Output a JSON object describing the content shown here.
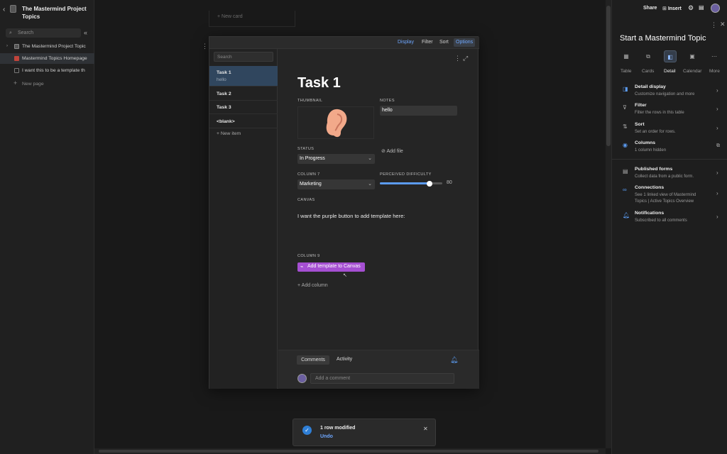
{
  "sidebar": {
    "title": "The Mastermind Project Topics",
    "search_placeholder": "Search",
    "items": [
      {
        "label": "The Mastermind Project Topic"
      },
      {
        "label": "Mastermind Topics Homepage"
      },
      {
        "label": "I want this to be a template th"
      }
    ],
    "new_page": "New page"
  },
  "board": {
    "new_card": "+ New card"
  },
  "modal": {
    "toolbar": {
      "display": "Display",
      "filter": "Filter",
      "sort": "Sort",
      "options": "Options"
    },
    "list_search_placeholder": "Search",
    "list": [
      {
        "title": "Task 1",
        "sub": "hello"
      },
      {
        "title": "Task 2"
      },
      {
        "title": "Task 3"
      },
      {
        "title": "<blank>"
      }
    ],
    "new_item": "+  New item",
    "detail": {
      "title": "Task 1",
      "thumbnail_label": "THUMBNAIL",
      "notes_label": "NOTES",
      "notes_value": "hello",
      "add_file": "Add file",
      "status_label": "STATUS",
      "status_value": "In Progress",
      "column7_label": "COLUMN 7",
      "column7_value": "Marketing",
      "difficulty_label": "PERCEIVED DIFFICULTY",
      "difficulty_value": "80",
      "difficulty_fraction": 0.8,
      "canvas_label": "CANVAS",
      "canvas_text": "I want the purple button to add template here:",
      "column9_label": "COLUMN 9",
      "button_label": "Add template to Canvas",
      "button_color": "#a54fd2",
      "add_column": "+ Add column"
    },
    "comments": {
      "tab_comments": "Comments",
      "tab_activity": "Activity",
      "placeholder": "Add a comment"
    }
  },
  "toast": {
    "message": "1 row modified",
    "action": "Undo"
  },
  "right_panel": {
    "share": "Share",
    "insert": "Insert",
    "title": "Start a Mastermind Topic",
    "views": [
      {
        "label": "Table",
        "icon": "table-icon"
      },
      {
        "label": "Cards",
        "icon": "cards-icon"
      },
      {
        "label": "Detail",
        "icon": "detail-icon"
      },
      {
        "label": "Calendar",
        "icon": "calendar-icon"
      },
      {
        "label": "More",
        "icon": "more-icon"
      }
    ],
    "rows": [
      {
        "title": "Detail display",
        "sub": "Customize navigation and more"
      },
      {
        "title": "Filter",
        "sub": "Filter the rows in this table"
      },
      {
        "title": "Sort",
        "sub": "Set an order for rows."
      },
      {
        "title": "Columns",
        "sub": "1 column hidden"
      },
      {
        "title": "Published forms",
        "sub": "Collect data from a public form."
      },
      {
        "title": "Connections",
        "sub": "See 1 linked view of Mastermind Topics | Active Topics Overview"
      },
      {
        "title": "Notifications",
        "sub": "Subscribed to all comments"
      }
    ]
  },
  "colors": {
    "accent": "#5b9bf0",
    "purple": "#a54fd2",
    "bg": "#191919"
  }
}
